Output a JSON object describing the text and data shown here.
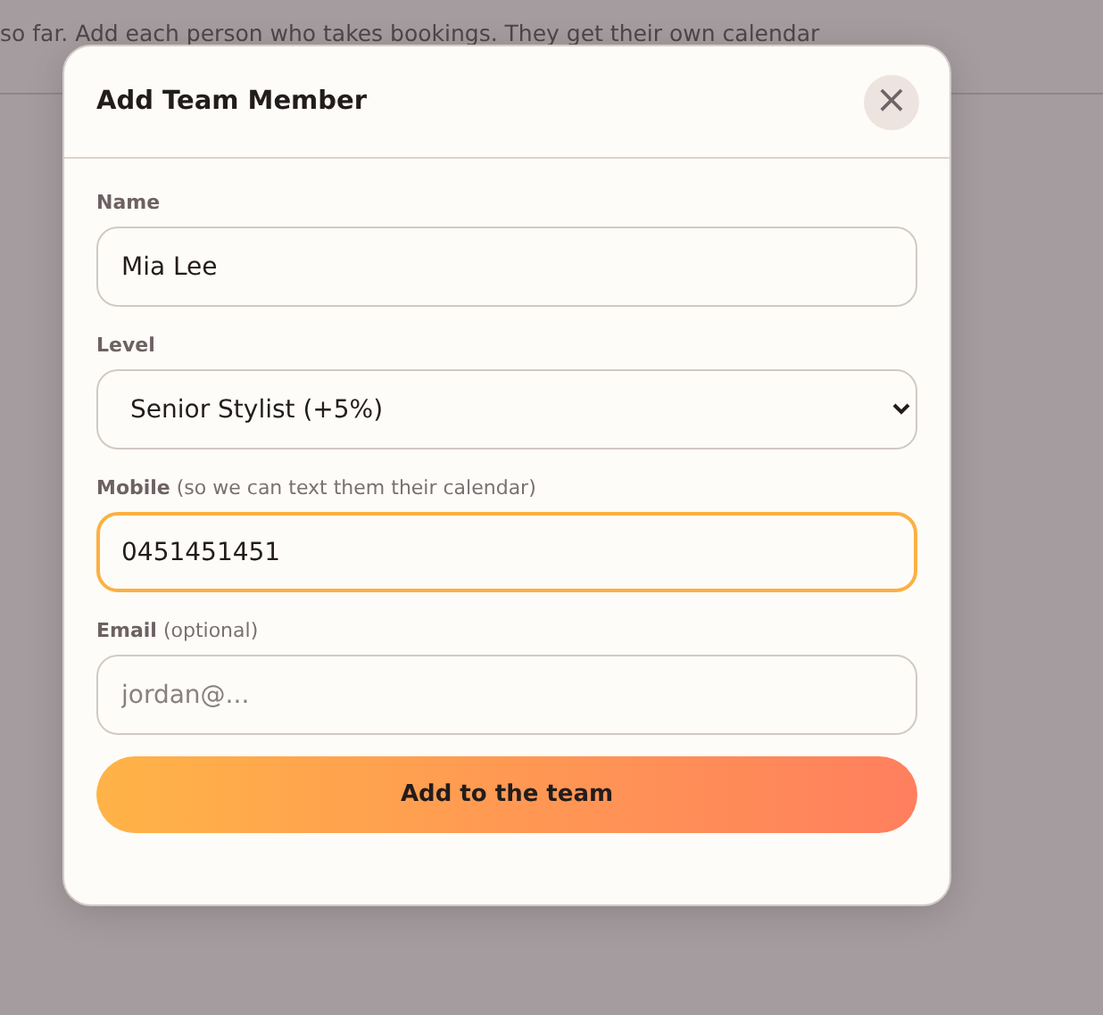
{
  "background": {
    "text": "so far. Add each person who takes bookings. They get their own calendar"
  },
  "dialog": {
    "title": "Add Team Member",
    "close_icon": "×",
    "fields": [
      {
        "kind": "text",
        "label": "**Name**",
        "value": "Mia Lee",
        "focused": false
      },
      {
        "kind": "select",
        "label": "**Level**",
        "value": "Senior Stylist (+5%)",
        "focused": false
      },
      {
        "kind": "text",
        "label": "**Mobile** (so we can text them their calendar)",
        "value": "0451451451",
        "focused": true
      },
      {
        "kind": "text",
        "label": "**Email** (optional)",
        "placeholder": "jordan@...",
        "focused": false
      }
    ],
    "submit": "Add to the team"
  }
}
